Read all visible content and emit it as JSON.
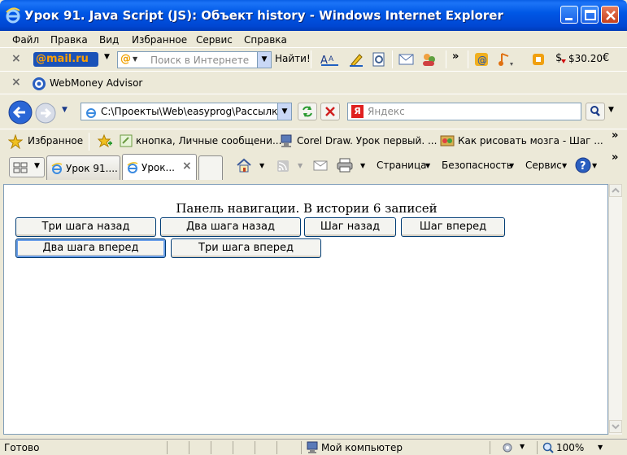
{
  "window": {
    "title": "Урок 91. Java Script (JS): Объект history - Windows Internet Explorer"
  },
  "menu": [
    "Файл",
    "Правка",
    "Вид",
    "Избранное",
    "Сервис",
    "Справка"
  ],
  "mailru_toolbar": {
    "logo": "@mail.ru",
    "search_placeholder": "Поиск в Интернете",
    "find_label": "Найти!",
    "balance": "$30.20",
    "currency2": "€"
  },
  "webmoney_toolbar": {
    "label": "WebMoney Advisor"
  },
  "address_bar": {
    "url": "C:\\Проекты\\Web\\easyprog\\Рассылки",
    "search_placeholder": "Яндекс"
  },
  "favorites_bar": {
    "favorites_label": "Избранное",
    "links": [
      "кнопка, Личные сообщени...",
      "Corel Draw. Урок первый. ...",
      "Как рисовать мозга - Шаг ..."
    ]
  },
  "tabs": [
    {
      "label": "Урок 91...."
    },
    {
      "label": "Урок..."
    }
  ],
  "command_bar": {
    "page": "Страница",
    "safety": "Безопасность",
    "tools": "Сервис"
  },
  "page": {
    "heading": "Панель навигации. В истории 6 записей",
    "buttons": [
      "Три шага назад",
      "Два шага назад",
      "Шаг назад",
      "Шаг вперед",
      "Два шага вперед",
      "Три шага вперед"
    ]
  },
  "status_bar": {
    "status": "Готово",
    "zone": "Мой компьютер",
    "zoom": "100%"
  }
}
